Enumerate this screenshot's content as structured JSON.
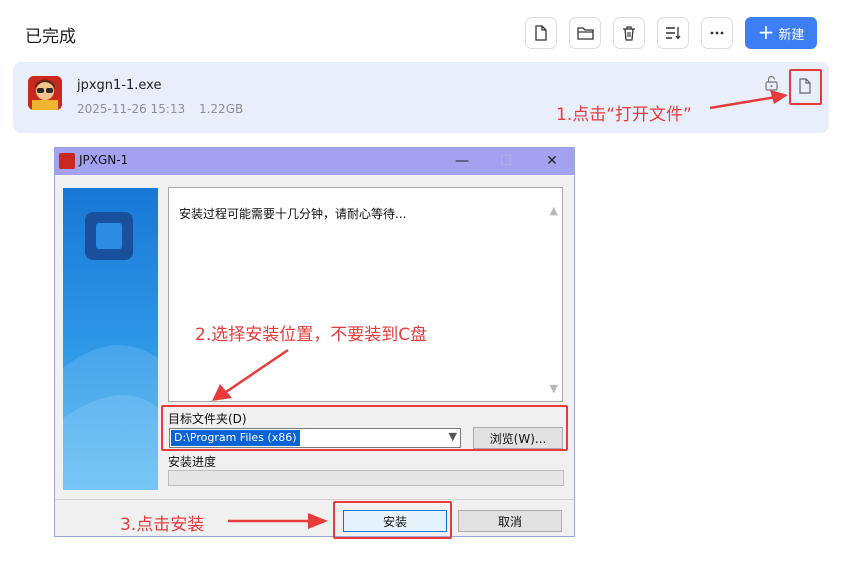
{
  "panel": {
    "title": "已完成",
    "new_button_label": "新建",
    "new_button_plus": "+"
  },
  "file": {
    "name": "jpxgn1-1.exe",
    "date": "2025-11-26 15:13",
    "size": "1.22GB"
  },
  "installer": {
    "title": "JPXGN-1",
    "minimize_glyph": "—",
    "maximize_glyph": "☐",
    "close_glyph": "✕",
    "message": "安装过程可能需要十几分钟，请耐心等待...",
    "target_folder_label": "目标文件夹(D)",
    "target_path": "D:\\Program Files (x86)",
    "browse_label": "浏览(W)...",
    "progress_label": "安装进度",
    "progress_fraction": 0,
    "install_label": "安装",
    "cancel_label": "取消"
  },
  "annotations": {
    "step1": "1.点击“打开文件”",
    "step2": "2.选择安装位置，不要装到C盘",
    "step3": "3.点击安装"
  },
  "colors": {
    "accent": "#3d7ef5",
    "annotation": "#e83b3b",
    "title_bar": "#a4a2f0",
    "selection": "#0a64d6"
  },
  "icons": [
    "new-file-icon",
    "folder-icon",
    "trash-icon",
    "sort-icon",
    "more-icon",
    "lock-icon",
    "open-file-icon"
  ]
}
